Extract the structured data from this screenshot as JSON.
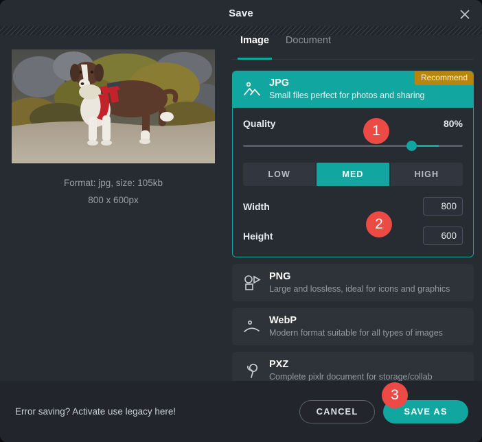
{
  "dialog": {
    "title": "Save",
    "close_icon": "close-icon"
  },
  "preview": {
    "format_line": "Format: jpg, size: 105kb",
    "dimension_line": "800 x 600px",
    "image_alt": "dog-on-beach-photo"
  },
  "tabs": [
    {
      "label": "Image",
      "active": true
    },
    {
      "label": "Document",
      "active": false
    }
  ],
  "formats": [
    {
      "name": "JPG",
      "description": "Small files perfect for photos and sharing",
      "badge": "Recommend",
      "icon": "image-mountain-icon",
      "selected": true
    },
    {
      "name": "PNG",
      "description": "Large and lossless, ideal for icons and graphics",
      "icon": "shapes-icon",
      "selected": false
    },
    {
      "name": "WebP",
      "description": "Modern format suitable for all types of images",
      "icon": "smiley-arc-icon",
      "selected": false
    },
    {
      "name": "PXZ",
      "description": "Complete pixlr document for storage/collab",
      "icon": "pxz-balloon-icon",
      "selected": false
    }
  ],
  "options": {
    "quality_label": "Quality",
    "quality_value": "80%",
    "presets": [
      {
        "label": "LOW",
        "active": false
      },
      {
        "label": "MED",
        "active": true
      },
      {
        "label": "HIGH",
        "active": false
      }
    ],
    "width_label": "Width",
    "width_value": "800",
    "height_label": "Height",
    "height_value": "600"
  },
  "footer": {
    "legacy_text": "Error saving? Activate use legacy here!",
    "cancel_label": "CANCEL",
    "save_label": "SAVE AS"
  },
  "annotations": [
    {
      "number": "1"
    },
    {
      "number": "2"
    },
    {
      "number": "3"
    }
  ],
  "colors": {
    "accent": "#12a6a0",
    "badge_red": "#ec4a45",
    "recommend_gold": "#b8860b",
    "panel": "#272b32",
    "card": "#2e333a",
    "footer": "#22262c"
  }
}
